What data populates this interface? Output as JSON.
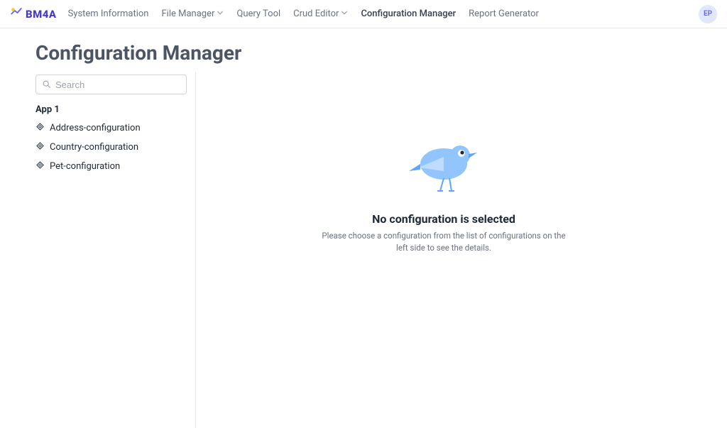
{
  "brand": {
    "name": "BM4A"
  },
  "nav": {
    "items": [
      {
        "label": "System Information",
        "dropdown": false,
        "active": false
      },
      {
        "label": "File Manager",
        "dropdown": true,
        "active": false
      },
      {
        "label": "Query Tool",
        "dropdown": false,
        "active": false
      },
      {
        "label": "Crud Editor",
        "dropdown": true,
        "active": false
      },
      {
        "label": "Configuration Manager",
        "dropdown": false,
        "active": true
      },
      {
        "label": "Report Generator",
        "dropdown": false,
        "active": false
      }
    ]
  },
  "user": {
    "initials": "EP"
  },
  "page": {
    "title": "Configuration Manager"
  },
  "search": {
    "placeholder": "Search",
    "value": ""
  },
  "sidebar": {
    "group_label": "App 1",
    "items": [
      {
        "label": "Address-configuration"
      },
      {
        "label": "Country-configuration"
      },
      {
        "label": "Pet-configuration"
      }
    ]
  },
  "empty_state": {
    "title": "No configuration is selected",
    "subtitle": "Please choose a configuration from the list of configurations on the left side to see the details."
  }
}
